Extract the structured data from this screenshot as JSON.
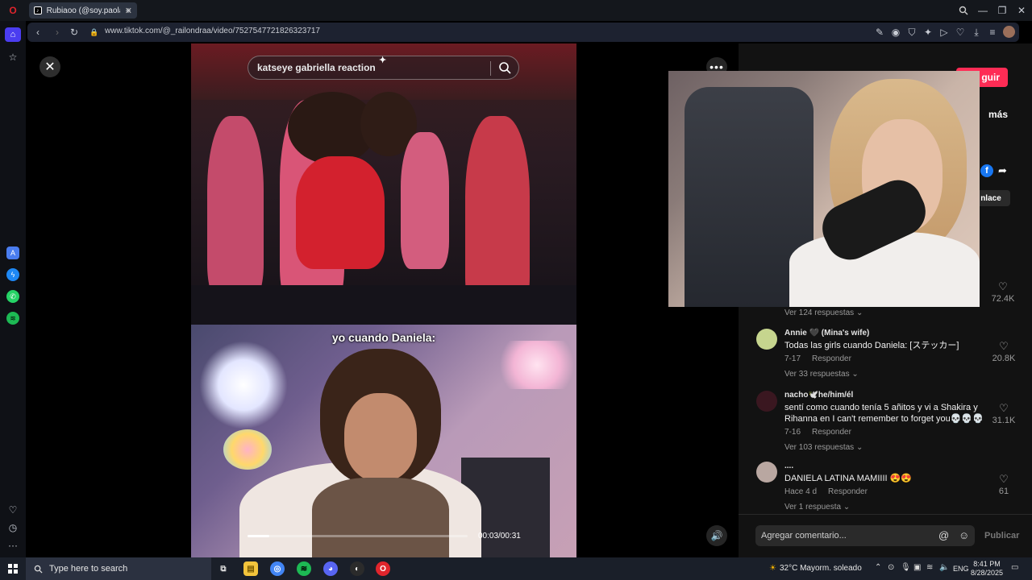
{
  "browser": {
    "tab_title": "Rubiaoo (@soy.paola",
    "url": "www.tiktok.com/@_railondraa/video/7527547721826323717"
  },
  "video": {
    "search_text": "katseye gabriella reaction",
    "caption": "yo cuando Daniela:",
    "time": "00:03/00:31",
    "progress_fraction": 0.1
  },
  "panel": {
    "follow_label": "guir",
    "more_label": "más",
    "link_label": "nlace",
    "top_replies": "Ver 124 respuestas",
    "top_likes": "72.4K"
  },
  "comments": [
    {
      "name": "Annie 🖤 (Mina's wife)",
      "text": "Todas las girls cuando Daniela: [ステッカー]",
      "date": "7-17",
      "reply_label": "Responder",
      "replies": "Ver 33 respuestas",
      "likes": "20.8K",
      "avatar_color": "#c6d58e"
    },
    {
      "name": "nacho🕊️he/him/él",
      "text": "sentí como cuando tenía 5 añitos y vi a Shakira y Rihanna en I can't remember to forget you💀💀💀",
      "date": "7-16",
      "reply_label": "Responder",
      "replies": "Ver 103 respuestas",
      "likes": "31.1K",
      "avatar_color": "#3a1720"
    },
    {
      "name": "....",
      "text": "DANIELA LATINA MAMIIII 😍😍",
      "date": "Hace 4 d",
      "reply_label": "Responder",
      "replies": "Ver 1 respuesta",
      "likes": "61",
      "avatar_color": "#b9a7a1"
    }
  ],
  "comment_input": {
    "placeholder": "Agregar comentario...",
    "publish_label": "Publicar"
  },
  "taskbar": {
    "search_placeholder": "Type here to search",
    "weather": "32°C  Mayorm. soleado",
    "lang": "ENG",
    "time": "8:41 PM",
    "date": "8/28/2025"
  }
}
